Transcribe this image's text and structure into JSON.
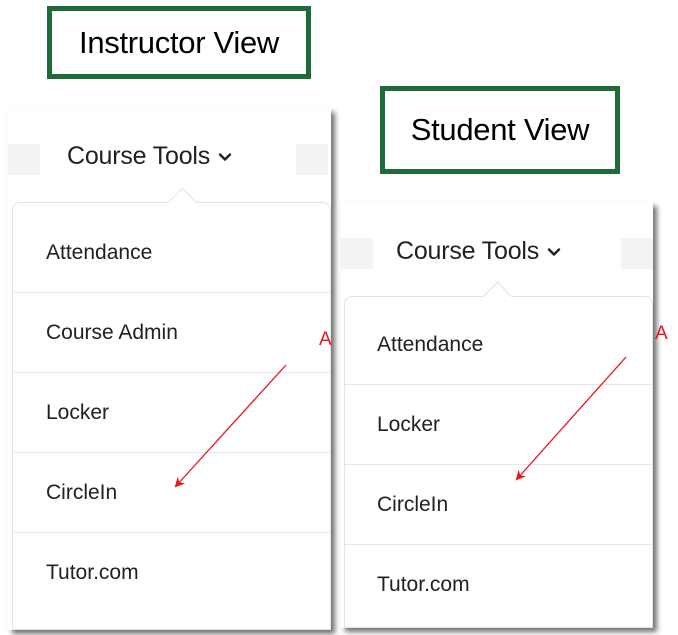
{
  "labels": {
    "instructor": "Instructor View",
    "student": "Student View"
  },
  "instructor_panel": {
    "title": "Course Tools",
    "menu": [
      "Attendance",
      "Course Admin",
      "Locker",
      "CircleIn",
      "Tutor.com"
    ]
  },
  "student_panel": {
    "title": "Course Tools",
    "menu": [
      "Attendance",
      "Locker",
      "CircleIn",
      "Tutor.com"
    ]
  },
  "annotations": {
    "instructor_letter": "A",
    "student_letter": "A"
  },
  "colors": {
    "label_border": "#1e6b3a",
    "annotation": "#e8151b",
    "menu_text": "#202122"
  },
  "icons": {
    "dropdown": "chevron-down-icon",
    "annotation_arrow": "arrow-icon"
  }
}
